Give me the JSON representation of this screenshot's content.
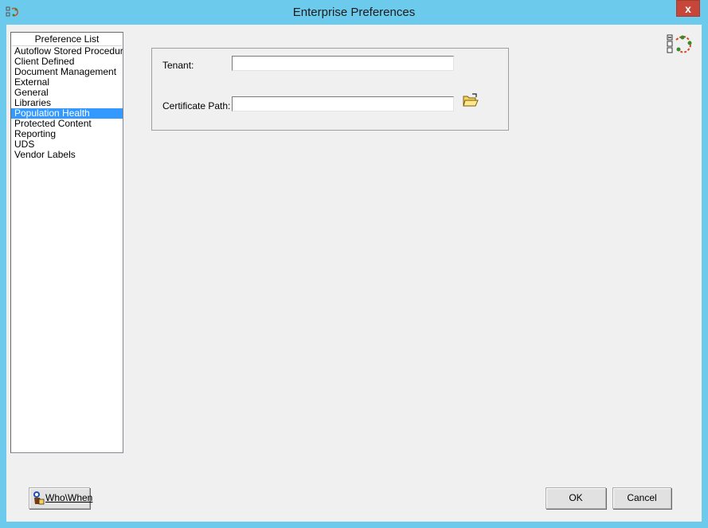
{
  "window": {
    "title": "Enterprise Preferences",
    "close_label": "x"
  },
  "preference_list": {
    "header": "Preference List",
    "items": [
      {
        "label": "Autoflow Stored Procedure",
        "selected": false
      },
      {
        "label": "Client Defined",
        "selected": false
      },
      {
        "label": "Document Management",
        "selected": false
      },
      {
        "label": "External",
        "selected": false
      },
      {
        "label": "General",
        "selected": false
      },
      {
        "label": "Libraries",
        "selected": false
      },
      {
        "label": "Population Health",
        "selected": true
      },
      {
        "label": "Protected Content",
        "selected": false
      },
      {
        "label": "Reporting",
        "selected": false
      },
      {
        "label": "UDS",
        "selected": false
      },
      {
        "label": "Vendor Labels",
        "selected": false
      }
    ]
  },
  "form": {
    "tenant_label": "Tenant:",
    "tenant_value": "",
    "certificate_label": "Certificate Path:",
    "certificate_value": ""
  },
  "buttons": {
    "who_when": "Who\\When",
    "ok": "OK",
    "cancel": "Cancel"
  },
  "icons": {
    "app": "app-icon",
    "folder": "folder-open-icon",
    "workflow": "workflow-icon",
    "who_when": "who-when-icon"
  },
  "colors": {
    "title_bar": "#6ccbec",
    "close_button": "#c7463a",
    "selection": "#3399ff",
    "client_bg": "#f0f0f0"
  }
}
